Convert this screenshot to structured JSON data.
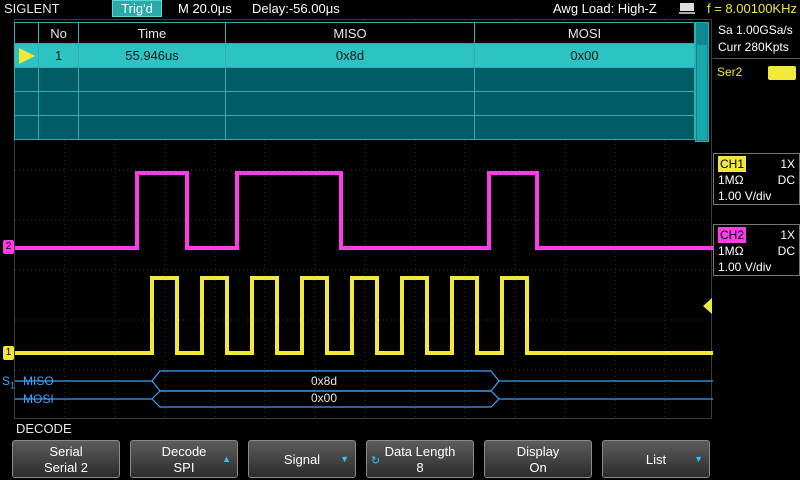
{
  "topbar": {
    "brand": "SIGLENT",
    "trigger_status": "Trig'd",
    "timebase": "M 20.0μs",
    "delay": "Delay:-56.00μs",
    "awg_load": "Awg Load: High-Z",
    "frequency": "f = 8.00100KHz"
  },
  "decode_table": {
    "headers": [
      "No",
      "Time",
      "MISO",
      "MOSI"
    ],
    "rows": [
      {
        "no": "1",
        "time": "55.946us",
        "miso": "0x8d",
        "mosi": "0x00",
        "selected": true
      },
      {
        "no": "",
        "time": "",
        "miso": "",
        "mosi": "",
        "selected": false
      },
      {
        "no": "",
        "time": "",
        "miso": "",
        "mosi": "",
        "selected": false
      },
      {
        "no": "",
        "time": "",
        "miso": "",
        "mosi": "",
        "selected": false
      }
    ]
  },
  "right_panel": {
    "sample_rate": "Sa 1.00GSa/s",
    "memory": "Curr 280Kpts",
    "serial_label": "Ser2",
    "ch1": {
      "name": "CH1",
      "probe": "1X",
      "impedance": "1MΩ",
      "coupling": "DC",
      "scale": "1.00 V/div"
    },
    "ch2": {
      "name": "CH2",
      "probe": "1X",
      "impedance": "1MΩ",
      "coupling": "DC",
      "scale": "1.00 V/div"
    }
  },
  "plot": {
    "ch2_marker": "2",
    "ch1_marker": "1",
    "bus_marker": "S",
    "bus_marker_sub": "1",
    "miso_label": "MISO",
    "mosi_label": "MOSI",
    "miso_value": "0x8d",
    "mosi_value": "0x00"
  },
  "colors": {
    "ch1": "#f2e83a",
    "ch2": "#ff3ce8",
    "decode": "#3ca2ff",
    "table": "#2ec3c3"
  },
  "menu": {
    "title": "DECODE",
    "softkeys": [
      {
        "line1": "Serial",
        "line2": "Serial 2"
      },
      {
        "line1": "Decode",
        "line2": "SPI"
      },
      {
        "line1": "Signal",
        "line2": ""
      },
      {
        "line1": "Data Length",
        "line2": "8"
      },
      {
        "line1": "Display",
        "line2": "On"
      },
      {
        "line1": "List",
        "line2": ""
      }
    ]
  }
}
